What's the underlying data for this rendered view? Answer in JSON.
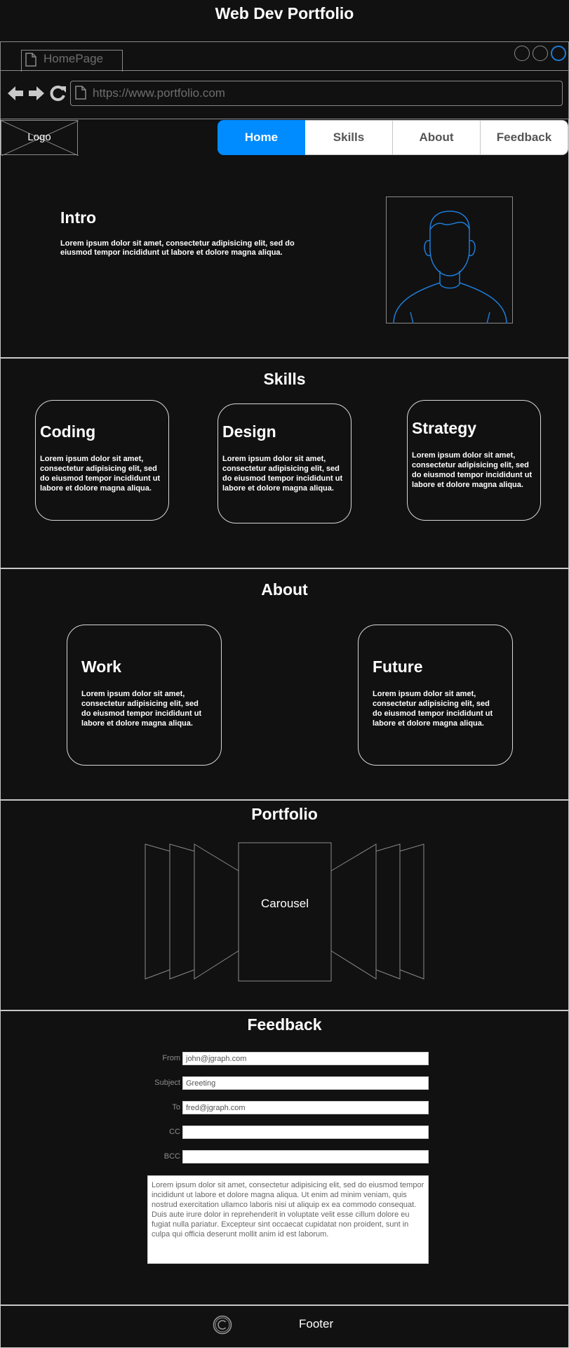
{
  "page": {
    "title": "Web Dev Portfolio"
  },
  "browser": {
    "tab_label": "HomePage",
    "url": "https://www.portfolio.com",
    "accent_color": "#1e7bd6",
    "icons": [
      "back-arrow-icon",
      "forward-arrow-icon",
      "refresh-icon",
      "page-icon"
    ]
  },
  "header": {
    "logo": "Logo",
    "nav": [
      {
        "label": "Home",
        "active": true
      },
      {
        "label": "Skills",
        "active": false
      },
      {
        "label": "About",
        "active": false
      },
      {
        "label": "Feedback",
        "active": false
      }
    ],
    "active_color": "#008cff"
  },
  "intro": {
    "title": "Intro",
    "text": "Lorem ipsum dolor sit amet, consectetur adipisicing elit, sed do eiusmod tempor incididunt ut labore et dolore magna aliqua."
  },
  "skills": {
    "title": "Skills",
    "cards": [
      {
        "title": "Coding",
        "text": "Lorem ipsum dolor sit amet, consectetur adipisicing elit, sed do eiusmod tempor incididunt ut labore et dolore magna aliqua."
      },
      {
        "title": "Design",
        "text": "Lorem ipsum dolor sit amet, consectetur adipisicing elit, sed do eiusmod tempor incididunt ut labore et dolore magna aliqua."
      },
      {
        "title": "Strategy",
        "text": "Lorem ipsum dolor sit amet, consectetur adipisicing elit, sed do eiusmod tempor incididunt ut labore et dolore magna aliqua."
      }
    ]
  },
  "about": {
    "title": "About",
    "cards": [
      {
        "title": "Work",
        "text": "Lorem ipsum dolor sit amet, consectetur adipisicing elit, sed do eiusmod tempor incididunt ut labore et dolore magna aliqua."
      },
      {
        "title": "Future",
        "text": "Lorem ipsum dolor sit amet, consectetur adipisicing elit, sed do eiusmod tempor incididunt ut labore et dolore magna aliqua."
      }
    ]
  },
  "portfolio": {
    "title": "Portfolio",
    "carousel_label": "Carousel"
  },
  "feedback": {
    "title": "Feedback",
    "fields": [
      {
        "label": "From",
        "value": "john@jgraph.com"
      },
      {
        "label": "Subject",
        "value": "Greeting"
      },
      {
        "label": "To",
        "value": "fred@jgraph.com"
      },
      {
        "label": "CC",
        "value": ""
      },
      {
        "label": "BCC",
        "value": ""
      }
    ],
    "message": "Lorem ipsum dolor sit amet, consectetur adipisicing elit, sed do eiusmod tempor incididunt ut labore et dolore magna aliqua. Ut enim ad minim veniam, quis nostrud exercitation ullamco laboris nisi ut aliquip ex ea commodo consequat. Duis aute irure dolor in reprehenderit in voluptate velit esse cillum dolore eu fugiat nulla pariatur. Excepteur sint occaecat cupidatat non proident, sunt in culpa qui officia deserunt mollit anim id est laborum."
  },
  "footer": {
    "text": "Footer",
    "icon": "copyright-icon"
  }
}
